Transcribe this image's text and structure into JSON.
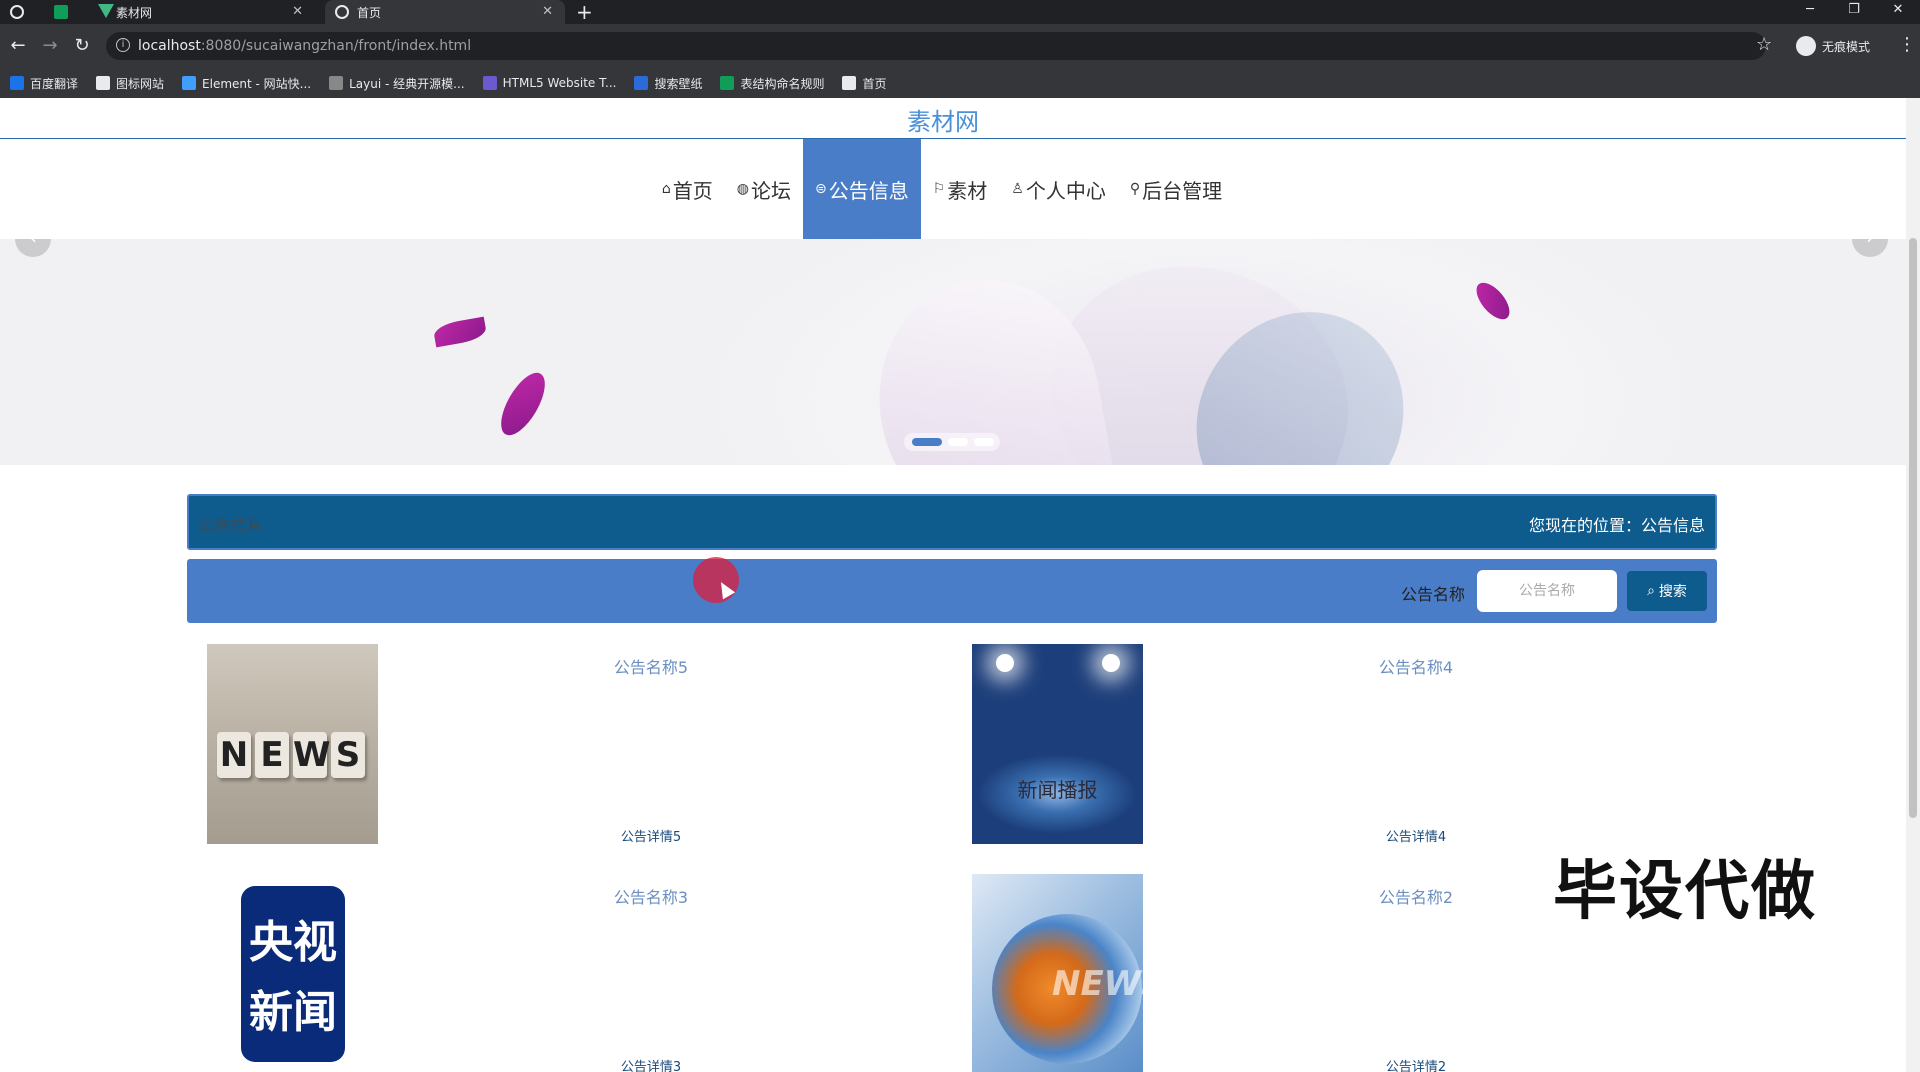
{
  "browser": {
    "tabs": [
      {
        "label": "素材网"
      },
      {
        "label": "首页"
      }
    ],
    "url_host": "localhost",
    "url_path": ":8080/sucaiwangzhan/front/index.html",
    "incognito_label": "无痕模式",
    "bookmarks": [
      {
        "label": "百度翻译",
        "color": "#1a73e8"
      },
      {
        "label": "图标网站",
        "color": "#e8eaed"
      },
      {
        "label": "Element - 网站快...",
        "color": "#409eff"
      },
      {
        "label": "Layui - 经典开源模...",
        "color": "#888888"
      },
      {
        "label": "HTML5 Website T...",
        "color": "#6a5acd"
      },
      {
        "label": "搜索壁纸",
        "color": "#2a6ad9"
      },
      {
        "label": "表结构命名规则",
        "color": "#0f9d58"
      },
      {
        "label": "首页",
        "color": "#e8eaed"
      }
    ]
  },
  "site": {
    "title": "素材网",
    "nav": [
      {
        "icon": "⌂",
        "label": "首页"
      },
      {
        "icon": "◍",
        "label": "论坛"
      },
      {
        "icon": "⊜",
        "label": "公告信息"
      },
      {
        "icon": "⚐",
        "label": "素材"
      },
      {
        "icon": "♙",
        "label": "个人中心"
      },
      {
        "icon": "⚲",
        "label": "后台管理"
      }
    ],
    "active_nav": "公告信息",
    "colors": {
      "accent": "#4a7dc8",
      "dark_accent": "#0e5c8e",
      "link": "#6a8fc0"
    }
  },
  "section": {
    "title": "公告信息",
    "location": "您现在的位置：公告信息"
  },
  "search": {
    "label": "公告名称",
    "placeholder": "公告名称",
    "button_label": "搜索"
  },
  "notices": [
    {
      "name": "公告名称5",
      "detail": "公告详情5",
      "image": "news-dice"
    },
    {
      "name": "公告名称4",
      "detail": "公告详情4",
      "image": "news-spotlight",
      "image_text": "新闻播报"
    },
    {
      "name": "公告名称3",
      "detail": "公告详情3",
      "image": "cctv-news",
      "image_text_1": "央视",
      "image_text_2": "新闻"
    },
    {
      "name": "公告名称2",
      "detail": "公告详情2",
      "image": "news-globe",
      "image_text": "NEWS"
    }
  ],
  "dice_letters": [
    "N",
    "E",
    "W",
    "S"
  ],
  "watermark": "毕设代做"
}
